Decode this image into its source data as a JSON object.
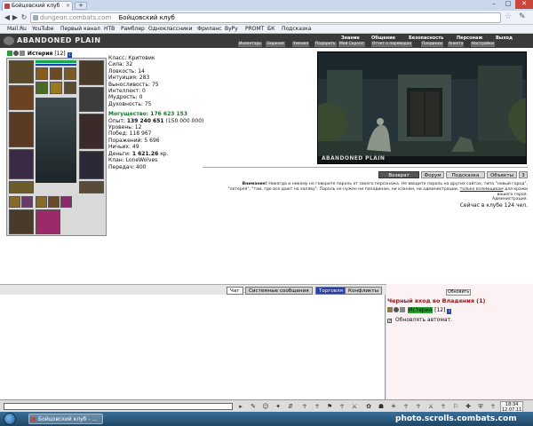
{
  "browser": {
    "tab_title": "Бойцовский клуб",
    "tab_close": "×",
    "new_tab": "+",
    "url_host": "dungeon.combats.com",
    "url_title": "Бойцовский клуб",
    "bookmarks": [
      "Mail.Ru",
      "YouTube",
      "Первый канал",
      "НТВ",
      "Рамблер",
      "Одноклассники",
      "Фриланс",
      "ВуРу",
      "PROMT",
      "БК",
      "Подсказка"
    ]
  },
  "game": {
    "logo": "ABANDONED PLAIN",
    "menu_top": [
      "Знание",
      "Общение",
      "Безопасность",
      "Персонаж",
      "Выход"
    ],
    "menu_bottom": [
      "Инвентарь",
      "Задания",
      "Умения",
      "Подарить",
      "Мой Скролл",
      "Отчет о переводах",
      "Поединки",
      "Анкета",
      "Настройки"
    ],
    "character": {
      "nick": "Истерия",
      "level": "[12]",
      "info_icon": "i",
      "class": "Класс: Критовик",
      "strength": "Сила: 32",
      "agility": "Ловкость: 14",
      "intuition": "Интуиция: 283",
      "endurance": "Выносливость: 75",
      "intellect": "Интеллект: 0",
      "wisdom": "Мудрость: 0",
      "spirituality": "Духовность: 75",
      "power": "Могущество: 176 623 153",
      "exp_label": "Опыт:",
      "exp_value": "139 240 651",
      "exp_next": "(150 000 000)",
      "level_line": "Уровень: 12",
      "wins": "Побед: 118 967",
      "losses": "Поражений: 5 696",
      "draws": "Ничьих: 49",
      "money_label": "Деньги:",
      "money_value": "1 621.26",
      "money_unit": "кр.",
      "clan": "Клан: LoneWolves",
      "transfers": "Передач: 400"
    },
    "scene_caption": "ABANDONED PLAIN",
    "buttons": [
      "Возврат",
      "Форум",
      "Подсказка",
      "Объекты",
      "3"
    ],
    "warning": {
      "bold": "Внимание!",
      "text1": "Никогда и никому не говорите пароль от своего персонажа. Не вводите пароль на других сайтах, типа \"новый город\",",
      "text2": "\"лотерея\", \"там, где все дают на халяву\". Пароль не нужен ни паладинам, ни кланам, ни администрации,",
      "underlined": "только взломщикам",
      "text3": "для кражи",
      "text4": "вашего героя.",
      "signature": "Администрация."
    },
    "online": "Сейчас в клубе 124 чел."
  },
  "chat": {
    "tabs": [
      "Чат",
      "Системные сообщения",
      "Торговля",
      "Конфликты"
    ],
    "refresh_button": "Обновить",
    "room_title": "Черный вход во Владения (1)",
    "member_nick": "Истерия",
    "member_level": "[12]",
    "auto_update": "Обновлять автомат.",
    "check": "✓"
  },
  "clock": {
    "time": "18:34",
    "date": "12.07.11"
  },
  "taskbar": {
    "task_title": "Бойцовский клуб - ..."
  },
  "watermark": "photo.scrolls.combats.com",
  "colors": {
    "hp_bar": "#16a84b",
    "mp_bar": "#1b3fb8",
    "power_text": "#0a7a1f",
    "room_title": "#8b1a1a",
    "trade_tab": "#2a3fa8"
  }
}
